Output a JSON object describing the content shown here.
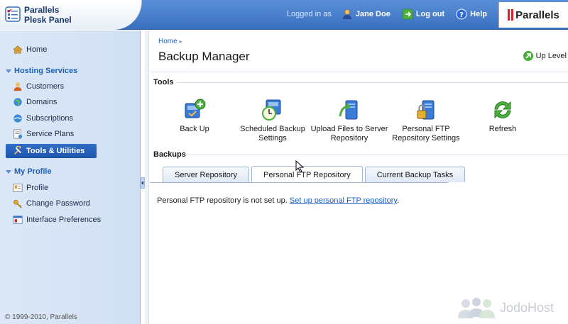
{
  "header": {
    "brand_line1": "Parallels",
    "brand_line2": "Plesk Panel",
    "logged_in_as": "Logged in as",
    "user_name": "Jane Doe",
    "logout_label": "Log out",
    "help_label": "Help",
    "logo_text": "Parallels"
  },
  "sidebar": {
    "home": "Home",
    "sections": [
      {
        "title": "Hosting Services",
        "items": [
          "Customers",
          "Domains",
          "Subscriptions",
          "Service Plans",
          "Tools & Utilities"
        ]
      },
      {
        "title": "My Profile",
        "items": [
          "Profile",
          "Change Password",
          "Interface Preferences"
        ]
      }
    ],
    "active_item": "Tools & Utilities",
    "copyright": "© 1999-2010, Parallels"
  },
  "main": {
    "breadcrumb": "Home",
    "title": "Backup Manager",
    "up_level": "Up Level",
    "tools_heading": "Tools",
    "tools": [
      {
        "line1": "Back Up",
        "line2": ""
      },
      {
        "line1": "Scheduled Backup",
        "line2": "Settings"
      },
      {
        "line1": "Upload Files to Server",
        "line2": "Repository"
      },
      {
        "line1": "Personal FTP",
        "line2": "Repository Settings"
      },
      {
        "line1": "Refresh",
        "line2": ""
      }
    ],
    "backups_heading": "Backups",
    "tabs": [
      "Server Repository",
      "Personal FTP Repository",
      "Current Backup Tasks"
    ],
    "active_tab": "Personal FTP Repository",
    "message_text": "Personal FTP repository is not set up. ",
    "message_link": "Set up personal FTP repository",
    "message_end": "."
  },
  "watermark": "JodoHost",
  "colors": {
    "accent": "#1a5fc0",
    "header": "#3a6fc0",
    "sidebar": "#dce8f7",
    "active": "#2f6dc8"
  }
}
